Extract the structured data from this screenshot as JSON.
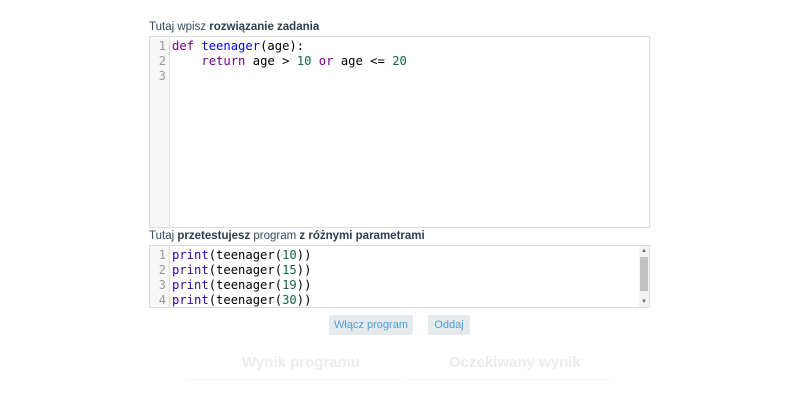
{
  "solution_label": {
    "prefix": "Tutaj wpisz ",
    "bold": "rozwiązanie zadania"
  },
  "solution_editor": {
    "line_numbers": [
      "1",
      "2",
      "3"
    ],
    "lines": [
      [
        {
          "t": "def",
          "c": "kw"
        },
        {
          "t": " ",
          "c": ""
        },
        {
          "t": "teenager",
          "c": "def"
        },
        {
          "t": "(age):",
          "c": ""
        }
      ],
      [
        {
          "t": "    ",
          "c": ""
        },
        {
          "t": "return",
          "c": "kw"
        },
        {
          "t": " age > ",
          "c": ""
        },
        {
          "t": "10",
          "c": "num"
        },
        {
          "t": " ",
          "c": ""
        },
        {
          "t": "or",
          "c": "kw"
        },
        {
          "t": " age <= ",
          "c": ""
        },
        {
          "t": "20",
          "c": "num"
        }
      ],
      []
    ]
  },
  "test_label": {
    "part1": "Tutaj ",
    "bold1": "przetestujesz",
    "part2": " program ",
    "bold2": "z różnymi parametrami"
  },
  "test_editor": {
    "line_numbers": [
      "1",
      "2",
      "3",
      "4"
    ],
    "lines": [
      [
        {
          "t": "print",
          "c": "builtin"
        },
        {
          "t": "(teenager(",
          "c": ""
        },
        {
          "t": "10",
          "c": "num"
        },
        {
          "t": "))",
          "c": ""
        }
      ],
      [
        {
          "t": "print",
          "c": "builtin"
        },
        {
          "t": "(teenager(",
          "c": ""
        },
        {
          "t": "15",
          "c": "num"
        },
        {
          "t": "))",
          "c": ""
        }
      ],
      [
        {
          "t": "print",
          "c": "builtin"
        },
        {
          "t": "(teenager(",
          "c": ""
        },
        {
          "t": "19",
          "c": "num"
        },
        {
          "t": "))",
          "c": ""
        }
      ],
      [
        {
          "t": "print",
          "c": "builtin"
        },
        {
          "t": "(teenager(",
          "c": ""
        },
        {
          "t": "30",
          "c": "num"
        },
        {
          "t": "))",
          "c": ""
        }
      ]
    ],
    "scroll_up_icon": "▲",
    "scroll_down_icon": "▼"
  },
  "buttons": {
    "run": "Włącz program",
    "submit": "Oddaj"
  },
  "results": {
    "program_output_title": "Wynik programu",
    "expected_output_title": "Oczekiwany wynik"
  },
  "colors": {
    "keyword": "#770088",
    "function_name": "#0000ff",
    "number": "#116644",
    "builtin": "#3300aa",
    "button_text": "#4a9fd8",
    "button_bg": "#e7eaec"
  }
}
